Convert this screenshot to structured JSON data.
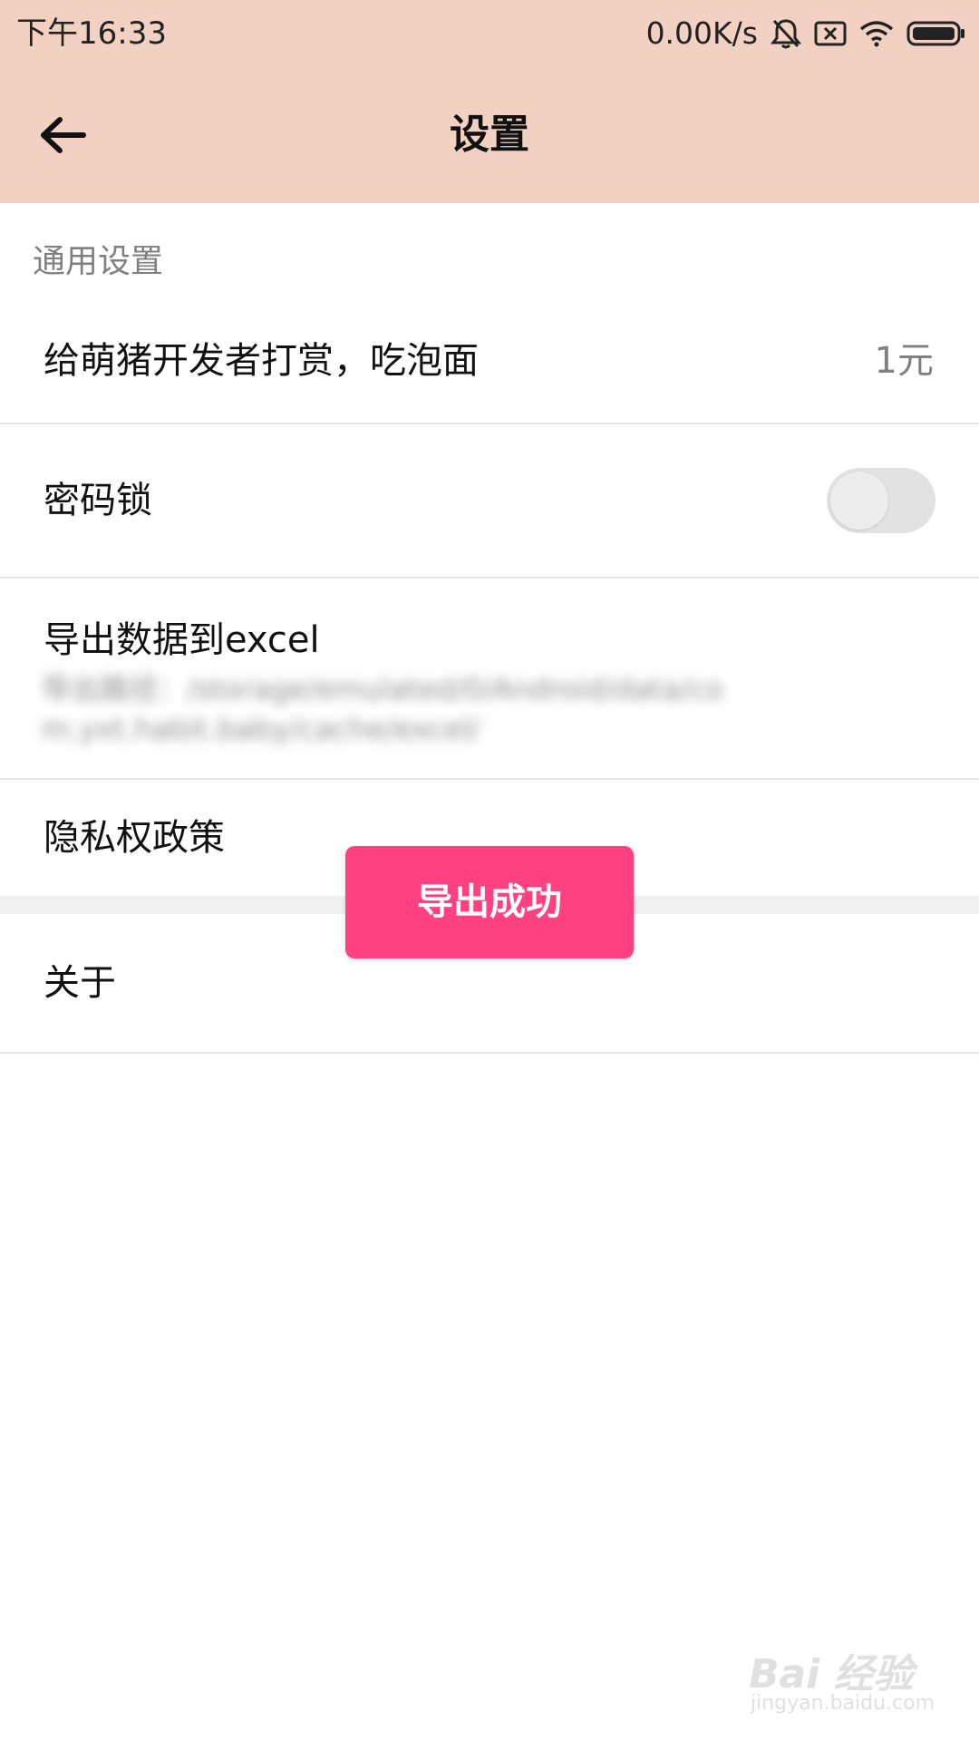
{
  "status_bar": {
    "time": "下午16:33",
    "network_speed": "0.00K/s",
    "icons": [
      "bell-muted-icon",
      "sim-error-icon",
      "wifi-icon",
      "battery-icon"
    ]
  },
  "app_bar": {
    "title": "设置",
    "back_icon": "arrow-left-icon",
    "background_color": "#f2d1c2"
  },
  "section": {
    "title": "通用设置"
  },
  "settings": {
    "reward": {
      "label": "给萌猪开发者打赏，吃泡面",
      "value": "1元"
    },
    "password_lock": {
      "label": "密码锁",
      "enabled": false
    },
    "export": {
      "label": "导出数据到excel",
      "subtitle": "导出路径：/storage/emulated/0/Android/data/com.yxt.habit.baby/cache/excel/"
    },
    "privacy": {
      "label": "隐私权政策"
    },
    "about": {
      "label": "关于"
    }
  },
  "toast": {
    "message": "导出成功",
    "color": "#ff4081"
  },
  "watermark": {
    "logo": "Bai 经验",
    "url": "jingyan.baidu.com"
  }
}
